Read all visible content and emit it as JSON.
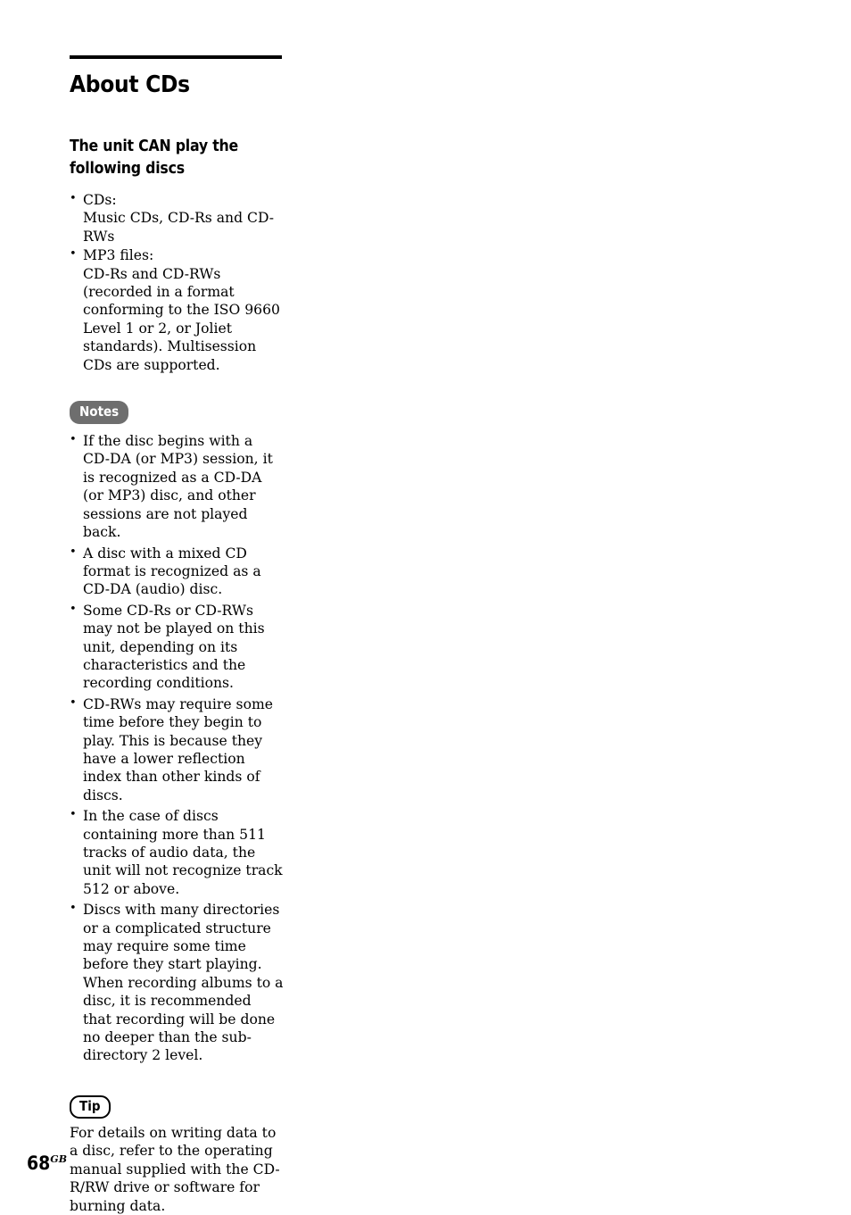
{
  "page": {
    "number": "68",
    "number_suffix": "GB"
  },
  "chapter": {
    "title": "About CDs"
  },
  "section": {
    "title": "The unit CAN play the following discs",
    "items": [
      {
        "lead": "CDs:",
        "detail": "Music CDs, CD-Rs and CD-RWs"
      },
      {
        "lead": "MP3 files:",
        "detail": "CD-Rs and CD-RWs (recorded in a format conforming to the ISO 9660 Level 1 or 2, or Joliet standards). Multisession CDs are supported."
      }
    ]
  },
  "notes": {
    "badge_label": "Notes",
    "badge_color": "#6e6e6e",
    "items": [
      "If the disc begins with a CD-DA (or MP3) session, it is recognized as a CD-DA (or MP3) disc, and other sessions are not played back.",
      "A disc with a mixed CD format is recognized as a CD-DA (audio) disc.",
      "Some CD-Rs or CD-RWs may not be played on this unit, depending on its characteristics and the recording conditions.",
      "CD-RWs may require some time before they begin to play. This is because they have a lower reflection index than other kinds of discs.",
      "In the case of discs containing more than 511 tracks of audio data, the unit will not recognize track 512 or above.",
      "Discs with many directories or a complicated structure may require some time before they start playing. When recording albums to a disc, it is recommended that recording will be done no deeper than the sub-directory 2 level."
    ]
  },
  "tip": {
    "badge_label": "Tip",
    "text": "For details on writing data to a disc, refer to the operating manual supplied with the CD-R/RW drive or software for burning data."
  }
}
